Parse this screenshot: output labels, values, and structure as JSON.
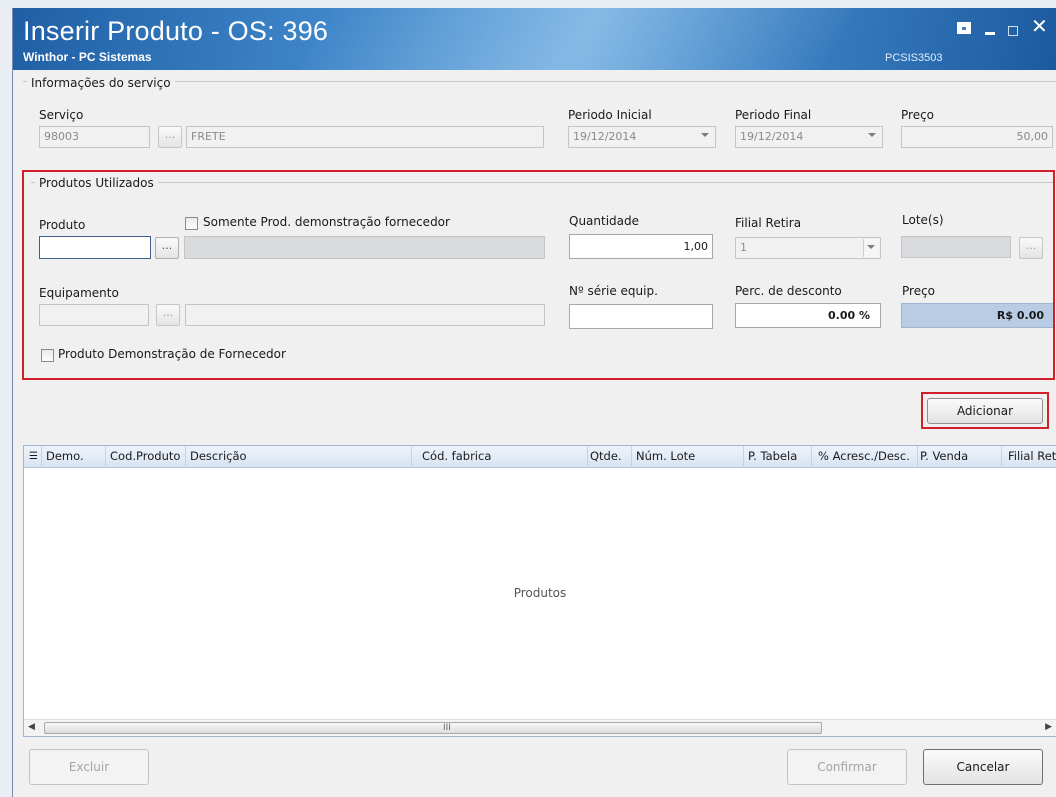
{
  "window": {
    "title": "Inserir Produto - OS: 396",
    "subtitle": "Winthor - PC Sistemas",
    "code": "PCSIS3503",
    "close_glyph": "✕"
  },
  "servico_group": {
    "title": "Informações do serviço",
    "servico_label": "Serviço",
    "servico_code": "98003",
    "servico_desc": "FRETE",
    "periodo_inicial_label": "Periodo Inicial",
    "periodo_inicial": "19/12/2014",
    "periodo_final_label": "Periodo Final",
    "periodo_final": "19/12/2014",
    "preco_label": "Preço",
    "preco": "50,00"
  },
  "produtos_group": {
    "title": "Produtos Utilizados",
    "produto_label": "Produto",
    "produto_value": "",
    "somente_demo_label": "Somente Prod. demonstração fornecedor",
    "quantidade_label": "Quantidade",
    "quantidade": "1,00",
    "filial_label": "Filial Retira",
    "filial": "1",
    "lote_label": "Lote(s)",
    "lote": "",
    "equipamento_label": "Equipamento",
    "serie_label": "Nº série equip.",
    "serie": "",
    "desconto_label": "Perc. de desconto",
    "desconto": "0.00 %",
    "preco_label": "Preço",
    "preco": "R$ 0.00",
    "demo_fornecedor_label": "Produto Demonstração de Fornecedor",
    "ellipsis": "..."
  },
  "buttons": {
    "adicionar": "Adicionar",
    "excluir": "Excluir",
    "confirmar": "Confirmar",
    "cancelar": "Cancelar"
  },
  "grid": {
    "columns": [
      "Demo.",
      "Cod.Produto",
      "Descrição",
      "Cód. fabrica",
      "Qtde.",
      "Núm. Lote",
      "P. Tabela",
      "% Acresc./Desc.",
      "P. Venda",
      "Filial Retira"
    ],
    "empty_text": "Produtos",
    "scroll_grip": "III"
  },
  "colors": {
    "accent_red": "#d0202a",
    "title_blue": "#2f72b8"
  }
}
